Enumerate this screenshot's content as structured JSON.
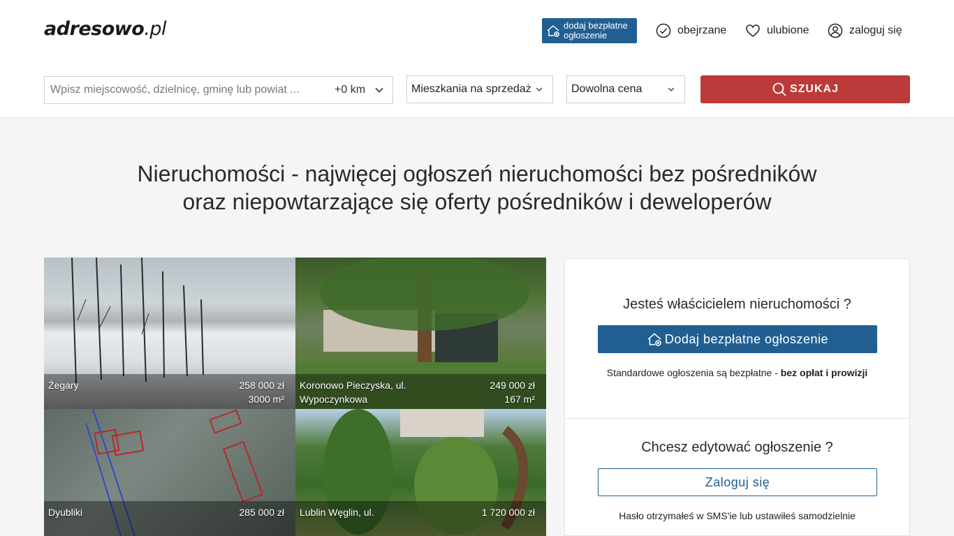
{
  "header": {
    "logo_main": "adresowo",
    "logo_tld": ".pl",
    "add_listing": {
      "line1": "dodaj bezpłatne",
      "line2": "ogłoszenie"
    },
    "viewed": "obejrzane",
    "favorites": "ulubione",
    "login": "zaloguj się"
  },
  "search": {
    "placeholder": "Wpisz miejscowość, dzielnicę, gminę lub powiat ...",
    "radius": "+0 km",
    "type": "Mieszkania na sprzedaż",
    "price": "Dowolna cena",
    "submit": "SZUKAJ"
  },
  "headline": {
    "line1": "Nieruchomości - najwięcej ogłoszeń nieruchomości bez pośredników",
    "line2": "oraz niepowtarzające się oferty pośredników i deweloperów"
  },
  "listings": [
    {
      "location": "Żegary",
      "price": "258 000 zł",
      "area": "3000 m²"
    },
    {
      "location": "Koronowo Pieczyska, ul. Wypoczynkowa",
      "price": "249 000 zł",
      "area": "167 m²"
    },
    {
      "location": "Dyubliki",
      "price": "285 000 zł",
      "area": ""
    },
    {
      "location": "Lublin Węglin, ul.",
      "price": "1 720 000 zł",
      "area": ""
    }
  ],
  "owner_panel": {
    "question": "Jesteś właścicielem nieruchomości ?",
    "button": "Dodaj bezpłatne ogłoszenie",
    "note_prefix": "Standardowe ogłoszenia są bezpłatne - ",
    "note_bold": "bez opłat i prowizji",
    "edit_question": "Chcesz edytować ogłoszenie ?",
    "login_button": "Zaloguj się",
    "password_note": "Hasło otrzymałeś w SMS'ie lub ustawiłeś samodzielnie"
  },
  "colors": {
    "brand_blue": "#215f92",
    "search_red": "#bc3a3a"
  },
  "icons": [
    "house-plus-icon",
    "check-circle-icon",
    "heart-icon",
    "user-circle-icon",
    "chevron-down-icon",
    "search-icon"
  ]
}
